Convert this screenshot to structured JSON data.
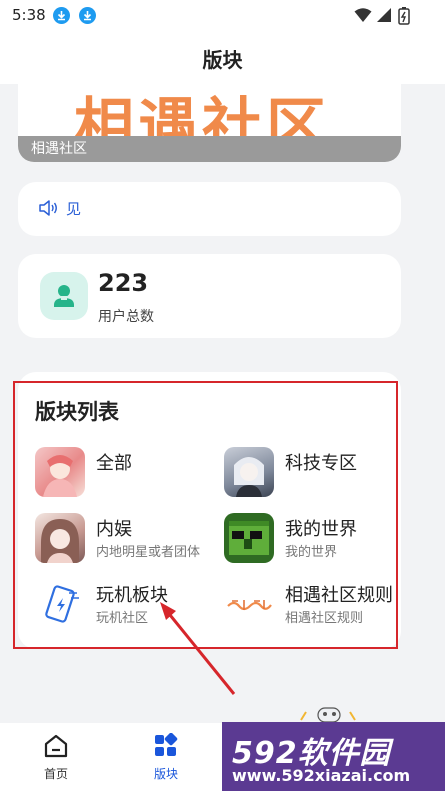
{
  "status_bar": {
    "time": "5:38"
  },
  "header": {
    "title": "版块"
  },
  "banner": {
    "art_text": "相遇社区",
    "caption": "相遇社区"
  },
  "notice": {
    "text": "见"
  },
  "stats": {
    "count": "223",
    "label": "用户总数"
  },
  "forum_list": {
    "title": "版块列表",
    "items": [
      {
        "name": "全部",
        "desc": ""
      },
      {
        "name": "科技专区",
        "desc": ""
      },
      {
        "name": "内娱",
        "desc": "内地明星或者团体"
      },
      {
        "name": "我的世界",
        "desc": "我的世界"
      },
      {
        "name": "玩机板块",
        "desc": "玩机社区"
      },
      {
        "name": "相遇社区规则",
        "desc": "相遇社区规则"
      }
    ]
  },
  "bottom_nav": {
    "home": "首页",
    "forum": "版块"
  },
  "watermark": {
    "main": "592软件园",
    "url": "www.592xiazai.com"
  },
  "colors": {
    "accent": "#1a56db",
    "highlight": "#d6262b",
    "notice": "#2a5fd6"
  }
}
